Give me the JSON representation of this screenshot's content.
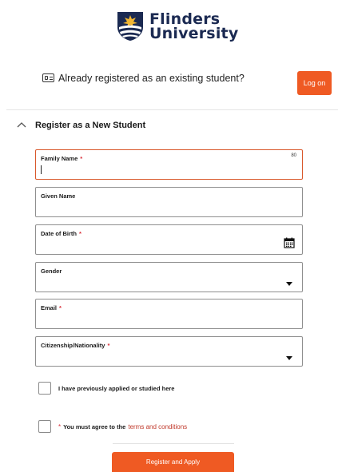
{
  "brand": {
    "name_line1": "Flinders",
    "name_line2": "University",
    "accent": "#ef5a23",
    "navy": "#1b2a52",
    "gold": "#f2b632"
  },
  "existing": {
    "icon": "id-card-icon",
    "text": "Already registered as an existing student?",
    "login_label": "Log on"
  },
  "section": {
    "icon": "chevron-up-icon",
    "title": "Register as a New Student"
  },
  "form": {
    "family_name": {
      "label": "Family Name",
      "required": "*",
      "counter": "80",
      "value": ""
    },
    "given_name": {
      "label": "Given Name",
      "value": ""
    },
    "dob": {
      "label": "Date of Birth",
      "required": "*",
      "icon": "calendar-icon",
      "value": ""
    },
    "gender": {
      "label": "Gender",
      "selected": ""
    },
    "email": {
      "label": "Email",
      "required": "*",
      "value": ""
    },
    "citizenship": {
      "label": "Citizenship/Nationality",
      "required": "*",
      "selected": ""
    }
  },
  "checks": {
    "previous": {
      "label": "I have previously applied or studied here",
      "checked": false
    },
    "terms": {
      "required": "*",
      "text": "You must agree to the",
      "link": "terms and conditions",
      "checked": false
    }
  },
  "submit_label": "Register and Apply"
}
